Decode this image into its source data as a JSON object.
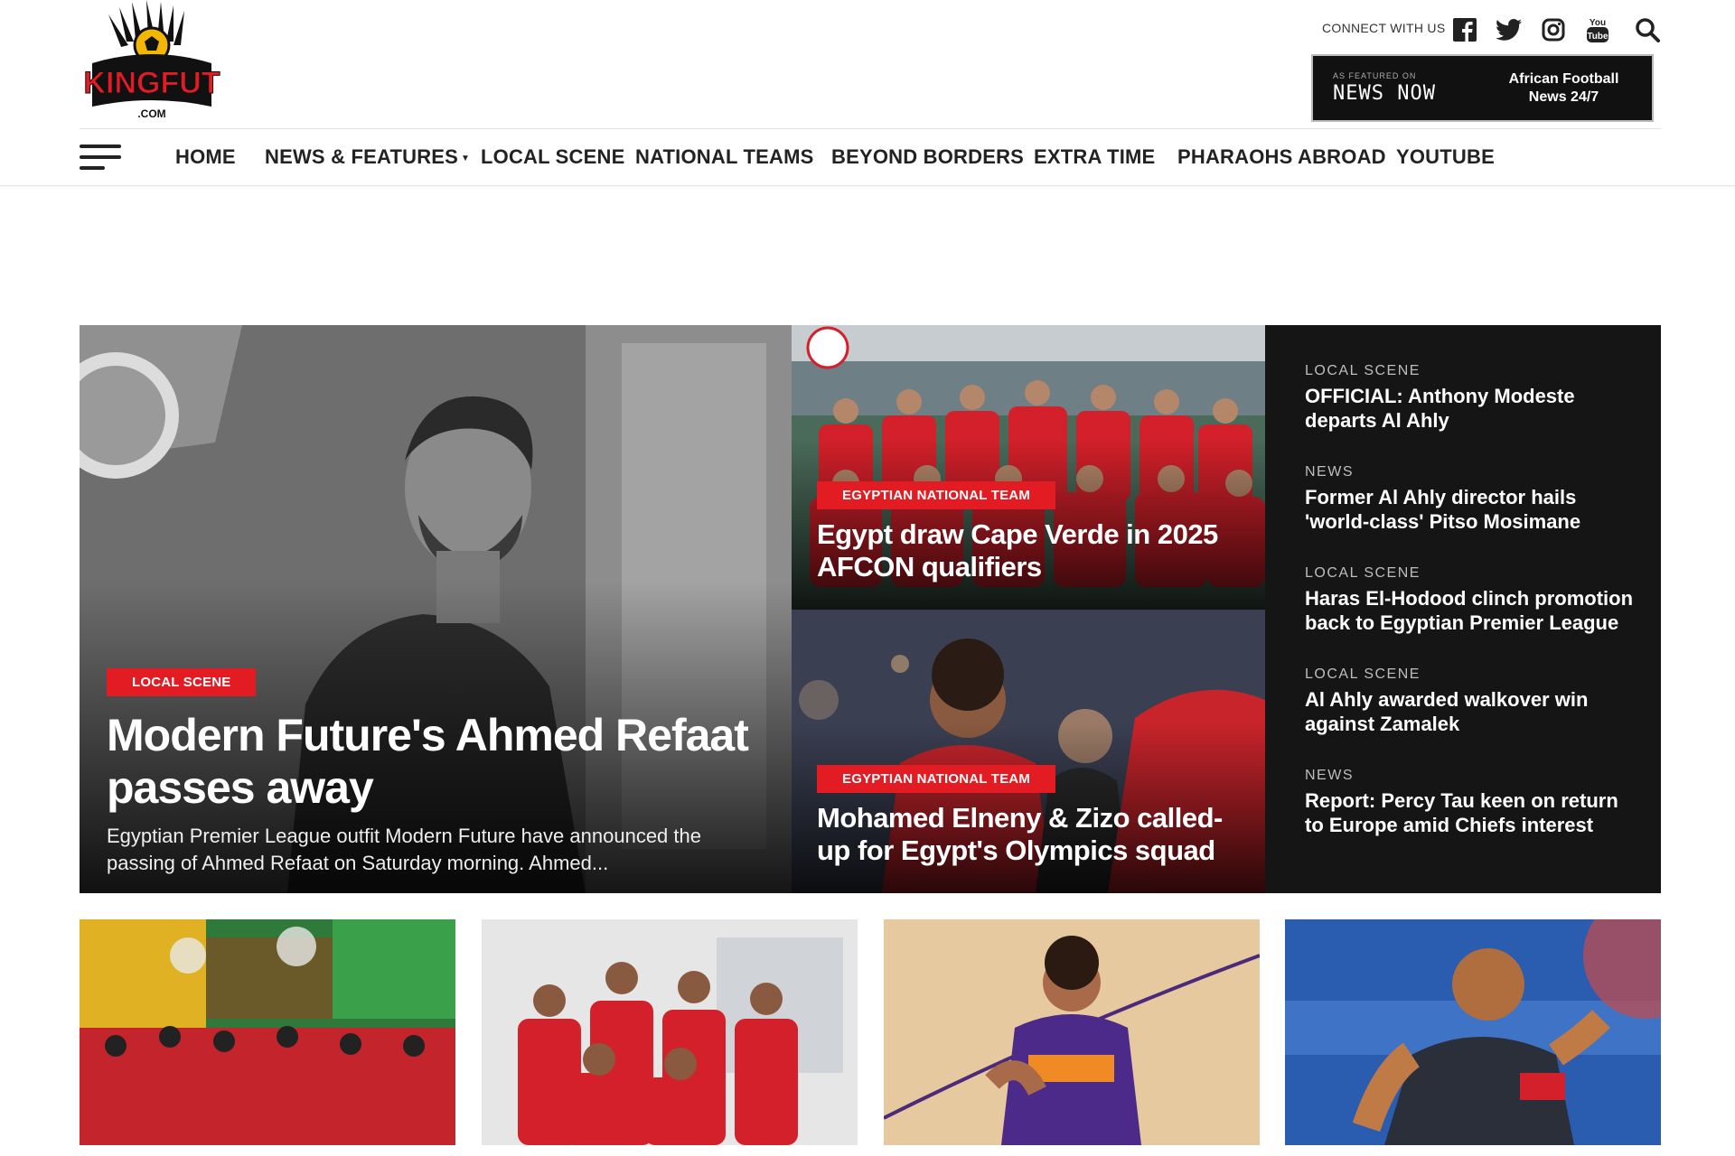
{
  "brand": {
    "logo_text": "KINGFUT",
    "logo_sub": ".COM"
  },
  "header": {
    "connect_label": "CONNECT WITH US",
    "social_icons": [
      "facebook-icon",
      "twitter-icon",
      "instagram-icon",
      "youtube-icon",
      "search-icon"
    ],
    "newsnow": {
      "small": "AS FEATURED ON",
      "big": "NEWS NOW",
      "right_line1": "African Football",
      "right_line2": "News 24/7"
    }
  },
  "nav": {
    "items": [
      "HOME",
      "NEWS & FEATURES",
      "LOCAL SCENE",
      "NATIONAL TEAMS",
      "BEYOND BORDERS",
      "EXTRA TIME",
      "PHARAOHS ABROAD",
      "YOUTUBE"
    ]
  },
  "featured": {
    "main": {
      "category": "LOCAL SCENE",
      "title": "Modern Future's Ahmed Refaat passes away",
      "excerpt": "Egyptian Premier League outfit Modern Future have announced the passing of Ahmed Refaat on Saturday morning. Ahmed..."
    },
    "side": [
      {
        "category": "EGYPTIAN NATIONAL TEAM",
        "title": "Egypt draw Cape Verde in 2025 AFCON qualifiers"
      },
      {
        "category": "EGYPTIAN NATIONAL TEAM",
        "title": "Mohamed Elneny & Zizo called-up for Egypt's Olympics squad"
      }
    ],
    "latest": [
      {
        "category": "LOCAL SCENE",
        "title": "OFFICIAL: Anthony Modeste departs Al Ahly"
      },
      {
        "category": "NEWS",
        "title": "Former Al Ahly director hails 'world-class' Pitso Mosimane"
      },
      {
        "category": "LOCAL SCENE",
        "title": "Haras El-Hodood clinch promotion back to Egyptian Premier League"
      },
      {
        "category": "LOCAL SCENE",
        "title": "Al Ahly awarded walkover win against Zamalek"
      },
      {
        "category": "NEWS",
        "title": "Report: Percy Tau keen on return to Europe amid Chiefs interest"
      }
    ]
  },
  "colors": {
    "accent": "#e31b23",
    "dark_panel": "#151515"
  }
}
